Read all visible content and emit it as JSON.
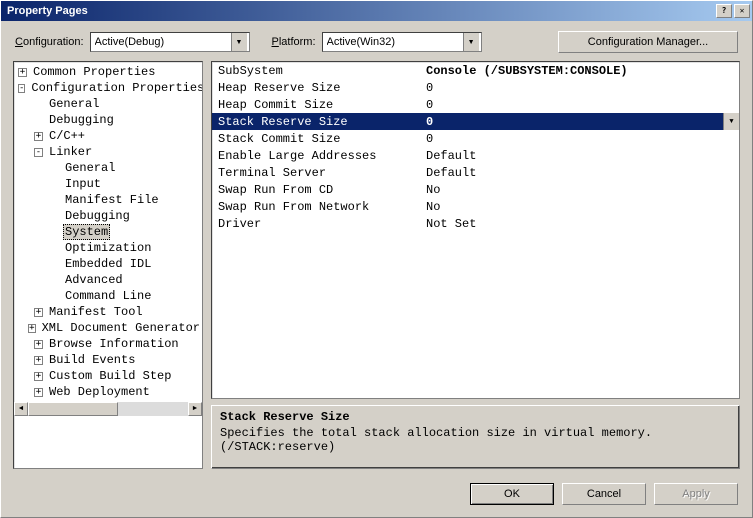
{
  "window": {
    "title": "Property Pages"
  },
  "toolbar": {
    "config_label": "Configuration:",
    "config_value": "Active(Debug)",
    "platform_label": "Platform:",
    "platform_value": "Active(Win32)",
    "config_mgr_label": "Configuration Manager..."
  },
  "tree": {
    "items": [
      {
        "depth": 0,
        "exp": "+",
        "label": "Common Properties"
      },
      {
        "depth": 0,
        "exp": "-",
        "label": "Configuration Properties"
      },
      {
        "depth": 1,
        "exp": "",
        "label": "General"
      },
      {
        "depth": 1,
        "exp": "",
        "label": "Debugging"
      },
      {
        "depth": 1,
        "exp": "+",
        "label": "C/C++"
      },
      {
        "depth": 1,
        "exp": "-",
        "label": "Linker"
      },
      {
        "depth": 2,
        "exp": "",
        "label": "General"
      },
      {
        "depth": 2,
        "exp": "",
        "label": "Input"
      },
      {
        "depth": 2,
        "exp": "",
        "label": "Manifest File"
      },
      {
        "depth": 2,
        "exp": "",
        "label": "Debugging"
      },
      {
        "depth": 2,
        "exp": "",
        "label": "System",
        "selected": true
      },
      {
        "depth": 2,
        "exp": "",
        "label": "Optimization"
      },
      {
        "depth": 2,
        "exp": "",
        "label": "Embedded IDL"
      },
      {
        "depth": 2,
        "exp": "",
        "label": "Advanced"
      },
      {
        "depth": 2,
        "exp": "",
        "label": "Command Line"
      },
      {
        "depth": 1,
        "exp": "+",
        "label": "Manifest Tool"
      },
      {
        "depth": 1,
        "exp": "+",
        "label": "XML Document Generator"
      },
      {
        "depth": 1,
        "exp": "+",
        "label": "Browse Information"
      },
      {
        "depth": 1,
        "exp": "+",
        "label": "Build Events"
      },
      {
        "depth": 1,
        "exp": "+",
        "label": "Custom Build Step"
      },
      {
        "depth": 1,
        "exp": "+",
        "label": "Web Deployment"
      }
    ]
  },
  "grid": {
    "rows": [
      {
        "name": "SubSystem",
        "value": "Console (/SUBSYSTEM:CONSOLE)",
        "bold": true
      },
      {
        "name": "Heap Reserve Size",
        "value": "0"
      },
      {
        "name": "Heap Commit Size",
        "value": "0"
      },
      {
        "name": "Stack Reserve Size",
        "value": "0",
        "highlight": true,
        "dropdown": true
      },
      {
        "name": "Stack Commit Size",
        "value": "0"
      },
      {
        "name": "Enable Large Addresses",
        "value": "Default"
      },
      {
        "name": "Terminal Server",
        "value": "Default"
      },
      {
        "name": "Swap Run From CD",
        "value": "No"
      },
      {
        "name": "Swap Run From Network",
        "value": "No"
      },
      {
        "name": "Driver",
        "value": "Not Set"
      }
    ]
  },
  "description": {
    "title": "Stack Reserve Size",
    "body": "Specifies the total stack allocation size in virtual memory. (/STACK:reserve)"
  },
  "footer": {
    "ok": "OK",
    "cancel": "Cancel",
    "apply": "Apply"
  }
}
